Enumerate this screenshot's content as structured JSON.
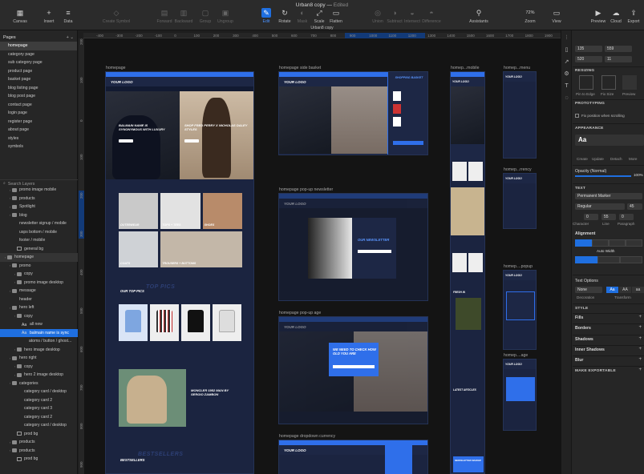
{
  "window": {
    "title": "Urban8 copy",
    "status": "Edited",
    "doc_tab": "Urban8 copy"
  },
  "toolbar": {
    "canvas": "Canvas",
    "insert": "Insert",
    "data": "Data",
    "create_symbol": "Create Symbol",
    "forward": "Forward",
    "backward": "Backward",
    "group": "Group",
    "ungroup": "Ungroup",
    "edit": "Edit",
    "rotate": "Rotate",
    "mask": "Mask",
    "scale": "Scale",
    "flatten": "Flatten",
    "union": "Union",
    "subtract": "Subtract",
    "intersect": "Intersect",
    "difference": "Difference",
    "assistants": "Assistants",
    "zoom_value": "72%",
    "zoom": "Zoom",
    "view": "View",
    "preview": "Preview",
    "cloud": "Cloud",
    "export": "Export"
  },
  "ruler": {
    "h_ticks": [
      "-400",
      "-300",
      "-200",
      "-100",
      "0",
      "100",
      "200",
      "300",
      "400",
      "500",
      "600",
      "700",
      "800",
      "900",
      "1000",
      "1100",
      "1200",
      "1300",
      "1400",
      "1500",
      "1600",
      "1700",
      "1800",
      "1900"
    ],
    "v_ticks": [
      "200",
      "100",
      "0",
      "100",
      "200",
      "300",
      "400",
      "500",
      "600",
      "700",
      "800",
      "900"
    ]
  },
  "pages": {
    "title": "Pages",
    "items": [
      "homepage",
      "category page",
      "sub category page",
      "product page",
      "basket page",
      "blog listing page",
      "blog post page",
      "contact page",
      "login page",
      "register page",
      "about page",
      "styles",
      "symbols"
    ]
  },
  "layers": {
    "search_placeholder": "Search Layers",
    "items": [
      {
        "label": "promo image mobile",
        "indent": 1,
        "icon": "folder"
      },
      {
        "label": "products",
        "indent": 1,
        "icon": "folder"
      },
      {
        "label": "Spotlight",
        "indent": 1,
        "icon": "folder"
      },
      {
        "label": "blog",
        "indent": 1,
        "icon": "folder"
      },
      {
        "label": "newsletter signup / mobile",
        "indent": 1,
        "icon": "symbol"
      },
      {
        "label": "usps bottom / mobile",
        "indent": 1,
        "icon": "symbol"
      },
      {
        "label": "footer / mobile",
        "indent": 1,
        "icon": "symbol"
      },
      {
        "label": "general bg",
        "indent": 2,
        "icon": "shape"
      },
      {
        "label": "homepage",
        "indent": 0,
        "icon": "folder",
        "state": "hl"
      },
      {
        "label": "promo",
        "indent": 1,
        "icon": "folder"
      },
      {
        "label": "copy",
        "indent": 2,
        "icon": "folder"
      },
      {
        "label": "promo image desktop",
        "indent": 2,
        "icon": "folder"
      },
      {
        "label": "message",
        "indent": 1,
        "icon": "folder"
      },
      {
        "label": "header",
        "indent": 1,
        "icon": "symbol"
      },
      {
        "label": "hero left",
        "indent": 1,
        "icon": "folder"
      },
      {
        "label": "copy",
        "indent": 2,
        "icon": "folder"
      },
      {
        "label": "all new",
        "indent": 3,
        "icon": "text"
      },
      {
        "label": "balmain name is sync",
        "indent": 3,
        "icon": "text",
        "state": "sel"
      },
      {
        "label": "atoms / button / ghost...",
        "indent": 3,
        "icon": "symbol"
      },
      {
        "label": "hero image desktop",
        "indent": 2,
        "icon": "folder"
      },
      {
        "label": "hero right",
        "indent": 1,
        "icon": "folder"
      },
      {
        "label": "copy",
        "indent": 2,
        "icon": "folder"
      },
      {
        "label": "hero 2 image desktop",
        "indent": 2,
        "icon": "folder"
      },
      {
        "label": "categories",
        "indent": 1,
        "icon": "folder"
      },
      {
        "label": "category card / desktop",
        "indent": 2,
        "icon": "symbol"
      },
      {
        "label": "category card 2",
        "indent": 2,
        "icon": "symbol"
      },
      {
        "label": "category card 3",
        "indent": 2,
        "icon": "symbol"
      },
      {
        "label": "category card 2",
        "indent": 2,
        "icon": "symbol"
      },
      {
        "label": "category card / desktop",
        "indent": 2,
        "icon": "symbol"
      },
      {
        "label": "prod bg",
        "indent": 2,
        "icon": "shape"
      },
      {
        "label": "products",
        "indent": 1,
        "icon": "folder"
      },
      {
        "label": "products",
        "indent": 1,
        "icon": "folder"
      },
      {
        "label": "prod bg",
        "indent": 2,
        "icon": "shape"
      }
    ]
  },
  "artboards": {
    "homepage": "homepage",
    "side_basket": "homepage side basket",
    "mobile": "homep...mobile",
    "menu": "homep...menu",
    "currency": "homep...rrency",
    "popup": "homep....popup",
    "age_mobile": "homep....age",
    "popup_newsletter": "homepage pop-up newsletter",
    "popup_age": "homepage pop-up age",
    "dropdown_currency": "homepage dropdown currency"
  },
  "content": {
    "logo": "YOUR LOGO",
    "hero_left": "BALMAIN NAME IS SYNONYMOUS WITH LUXURY",
    "hero_right": "SHOP FRED PERRY X NICHOLAS DALEY STYLES",
    "cat1": "OUTERWEAR",
    "cat2": "TOPS + TEES",
    "cat3": "SHOES",
    "cat4": "COATS",
    "cat5": "TROUSERS + BOTTOMS",
    "top_picks": "OUR TOP PICS",
    "top_picks_bg": "TOP PICS",
    "promo": "MONCLER 1952 MAN BY SERGIO ZAMBON",
    "bestsellers": "BESTSELLERS",
    "bestsellers_bg": "BESTSELLERS",
    "basket_title": "SHOPPING BASKET",
    "newsletter": "OUR NEWSLETTER",
    "age_check": "WE NEED TO CHECK HOW OLD YOU ARE",
    "latest_articles": "LATEST ARTICLES",
    "newsletter_signup": "NEWSLETTER SIGNUP",
    "fresh_in": "FRESH IN"
  },
  "inspector": {
    "x": "135",
    "y": "559",
    "w": "520",
    "h": "11",
    "resizing": "RESIZING",
    "pin_to_edge": "Pin to Edge",
    "fix_size": "Fix Size",
    "preview": "Preview",
    "prototyping": "PROTOTYPING",
    "fix_position": "Fix position when scrolling",
    "appearance": "APPEARANCE",
    "style_name": "Aa",
    "create": "Create",
    "update": "Update",
    "detach": "Detach",
    "more": "More",
    "opacity_label": "Opacity (Normal)",
    "opacity_value": "100%",
    "text": "TEXT",
    "font": "Permanent Marker",
    "weight": "Regular",
    "size": "45",
    "character_value": "0",
    "line_value": "55",
    "paragraph_value": "0",
    "character": "Character",
    "line": "Line",
    "paragraph": "Paragraph",
    "alignment": "Alignment",
    "auto_width": "Auto Width",
    "text_options": "Text Options",
    "decoration_value": "None",
    "transform_aa1": "Aa",
    "transform_aa2": "AA",
    "transform_aa3": "aa",
    "decoration": "Decoration",
    "transform": "Transform",
    "style": "STYLE",
    "fills": "Fills",
    "borders": "Borders",
    "shadows": "Shadows",
    "inner_shadows": "Inner Shadows",
    "blur": "Blur",
    "make_exportable": "MAKE EXPORTABLE"
  },
  "colors": {
    "accent": "#1f6fe0",
    "canvas": "#141414",
    "panel": "#262626",
    "artboard": "#1b2440",
    "brand_blue": "#2f6fea"
  }
}
